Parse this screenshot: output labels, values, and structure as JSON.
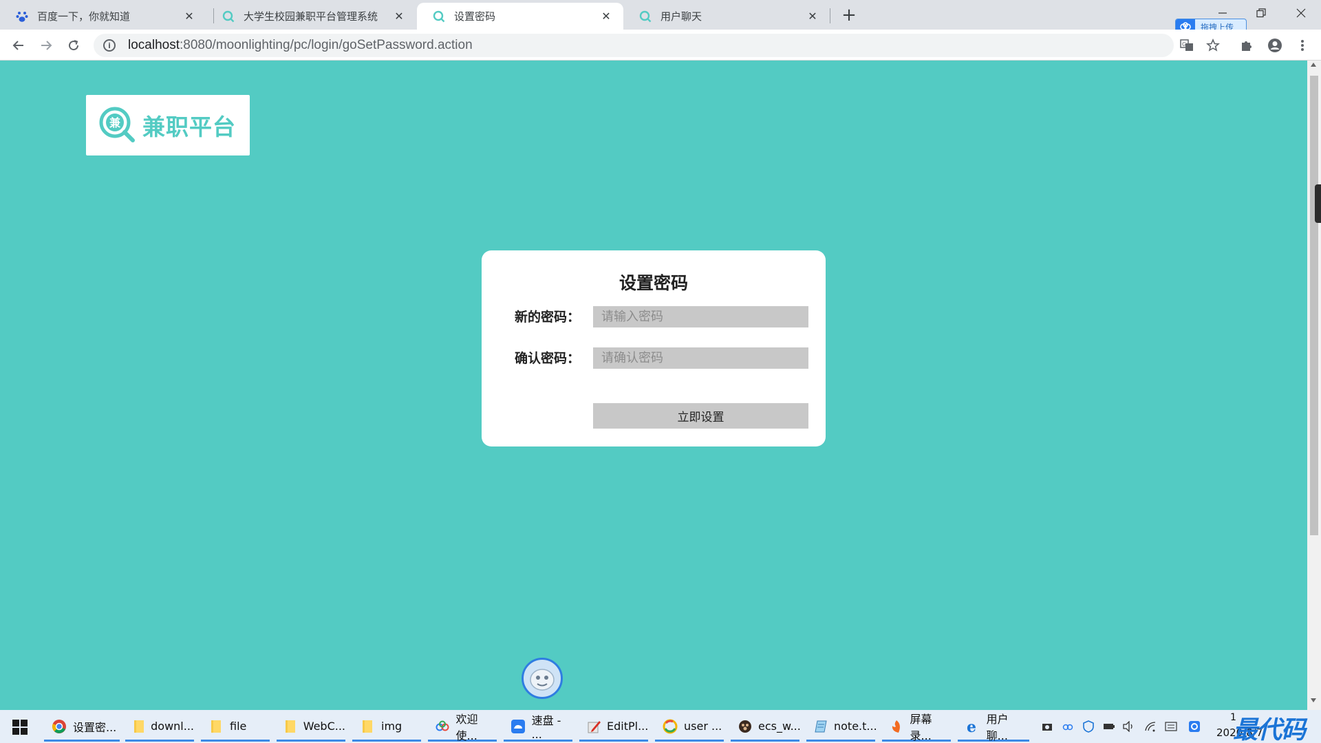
{
  "browser": {
    "tabs": [
      {
        "title": "百度一下，你就知道",
        "icon": "baidu-paw-icon",
        "active": false
      },
      {
        "title": "大学生校园兼职平台管理系统",
        "icon": "search-logo-icon",
        "active": false
      },
      {
        "title": "设置密码",
        "icon": "search-logo-icon",
        "active": true
      },
      {
        "title": "用户聊天",
        "icon": "search-logo-icon",
        "active": false
      }
    ],
    "close_glyph": "✕",
    "new_tab_glyph": "+",
    "cloud_upload_label": "拖拽上传",
    "url_host": "localhost",
    "url_path": ":8080/moonlighting/pc/login/goSetPassword.action"
  },
  "page": {
    "logo_text": "兼职平台",
    "logo_mark_char": "兼",
    "brand_color": "#53cbc3",
    "card": {
      "title": "设置密码",
      "new_password_label": "新的密码：",
      "new_password_placeholder": "请输入密码",
      "confirm_password_label": "确认密码：",
      "confirm_password_placeholder": "请确认密码",
      "submit_label": "立即设置"
    }
  },
  "taskbar": {
    "items": [
      {
        "label": "设置密...",
        "icon": "chrome-icon"
      },
      {
        "label": "downl...",
        "icon": "folder-icon"
      },
      {
        "label": "file",
        "icon": "folder-icon"
      },
      {
        "label": "WebC...",
        "icon": "folder-icon"
      },
      {
        "label": "img",
        "icon": "folder-icon"
      },
      {
        "label": "欢迎使...",
        "icon": "baidu-netdisk-icon"
      },
      {
        "label": "速盘 - ...",
        "icon": "speedpan-icon"
      },
      {
        "label": "EditPl...",
        "icon": "editplus-icon"
      },
      {
        "label": "user ...",
        "icon": "browser-icon"
      },
      {
        "label": "ecs_w...",
        "icon": "app-icon"
      },
      {
        "label": "note.t...",
        "icon": "notepad-icon"
      },
      {
        "label": "屏幕录...",
        "icon": "recorder-icon"
      },
      {
        "label": "用户聊...",
        "icon": "ie-icon"
      }
    ],
    "clock_date": "2020/8/7",
    "clock_time_partial": "1",
    "watermark": "最代码"
  }
}
